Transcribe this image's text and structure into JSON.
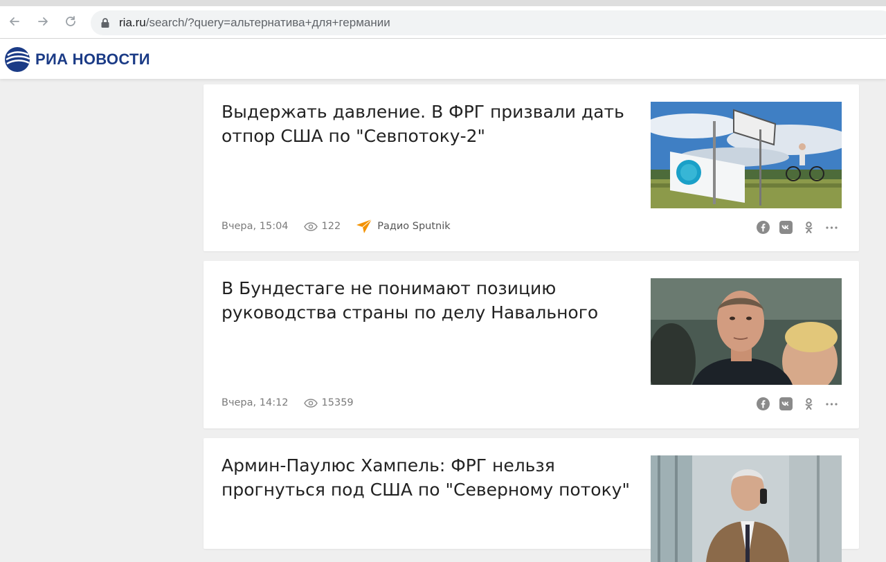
{
  "browser": {
    "url_host": "ria.ru",
    "url_path": "/search/?query=альтернатива+для+германии"
  },
  "site": {
    "logo_text": "РИА НОВОСТИ",
    "brand_color": "#1b3b86"
  },
  "articles": [
    {
      "title": "Выдержать давление. В ФРГ призвали дать отпор США по \"Севпотоку-2\"",
      "time": "Вчера, 15:04",
      "views": "122",
      "source": "Радио Sputnik",
      "image": "nord-stream-sign-photo"
    },
    {
      "title": "В Бундестаге не понимают позицию руководства страны по делу Навального",
      "time": "Вчера, 14:12",
      "views": "15359",
      "image": "portrait-photo"
    },
    {
      "title": "Армин-Паулюс Хампель: ФРГ нельзя прогнуться под США по \"Северному потоку\"",
      "image": "man-on-phone-photo"
    }
  ],
  "colors": {
    "sputnik_orange": "#f39200",
    "meta_gray": "#7a7a7a",
    "share_gray": "#8a8a8a"
  }
}
